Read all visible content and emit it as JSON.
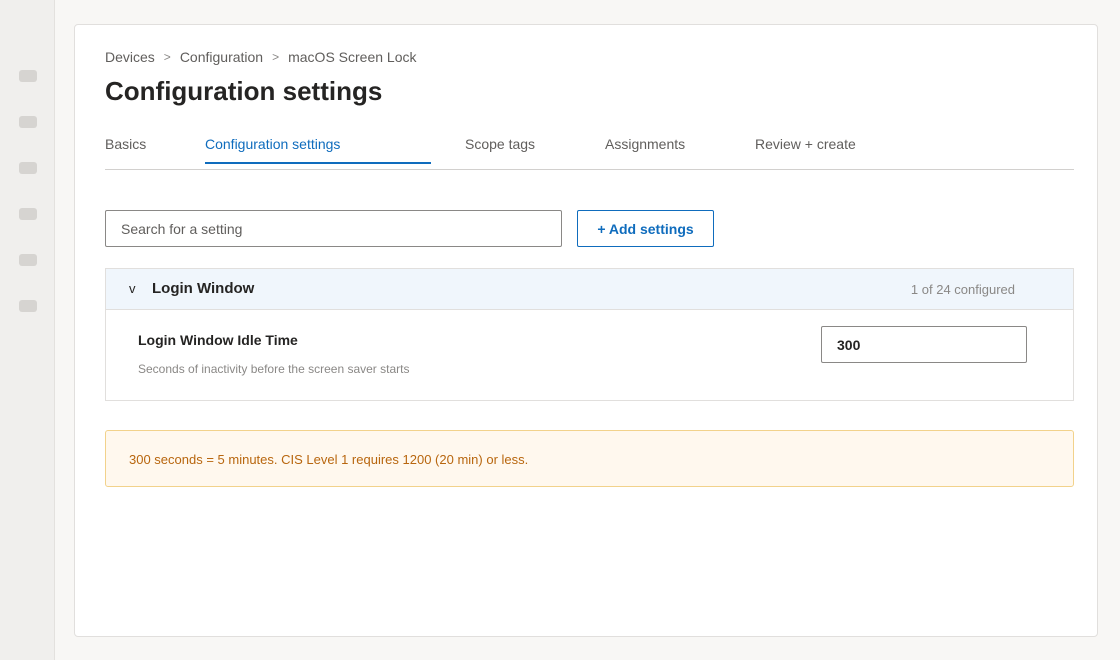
{
  "sidebar": {
    "icons": [
      "nav-icon",
      "nav-icon",
      "nav-icon",
      "nav-icon",
      "nav-icon",
      "nav-icon"
    ]
  },
  "breadcrumb": {
    "items": [
      "Devices",
      "Configuration",
      "macOS Screen Lock"
    ],
    "separator": ">"
  },
  "page": {
    "title": "Configuration settings"
  },
  "tabs": [
    {
      "label": "Basics",
      "active": false
    },
    {
      "label": "Configuration settings",
      "active": true
    },
    {
      "label": "Scope tags",
      "active": false
    },
    {
      "label": "Assignments",
      "active": false
    },
    {
      "label": "Review + create",
      "active": false
    }
  ],
  "search": {
    "placeholder": "Search for a setting",
    "value": ""
  },
  "toolbar": {
    "add_settings_label": "+ Add settings"
  },
  "group": {
    "chevron": "v",
    "title": "Login Window",
    "count": "1 of 24 configured",
    "setting": {
      "label": "Login Window Idle Time",
      "description": "Seconds of inactivity before the screen saver starts",
      "value": "300"
    }
  },
  "notice": {
    "text": "300 seconds = 5 minutes.  CIS Level 1 requires 1200 (20 min) or less."
  },
  "colors": {
    "accent": "#0f6cbd",
    "warning_text": "#b8660e",
    "warning_bg": "#fff8ee",
    "group_header_bg": "#f0f6fc"
  }
}
